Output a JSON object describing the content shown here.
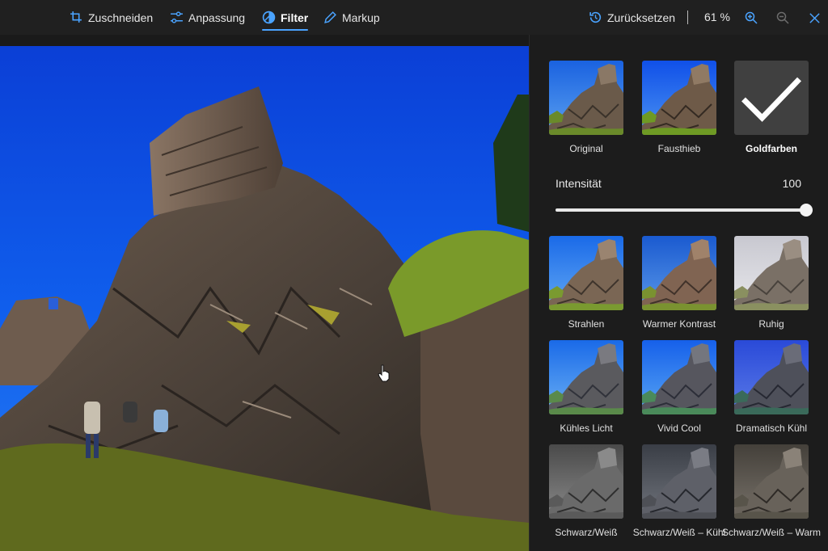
{
  "toolbar": {
    "tools": [
      {
        "label": "Zuschneiden",
        "icon": "crop-icon",
        "active": false
      },
      {
        "label": "Anpassung",
        "icon": "sliders-icon",
        "active": false
      },
      {
        "label": "Filter",
        "icon": "filter-icon",
        "active": true
      },
      {
        "label": "Markup",
        "icon": "pen-icon",
        "active": false
      }
    ],
    "reset_label": "Zurücksetzen",
    "zoom": "61 %",
    "accent_color": "#4aa3ff"
  },
  "panel": {
    "intensity_label": "Intensität",
    "intensity_value": 100,
    "filters": [
      {
        "label": "Original",
        "variant": "original",
        "selected": false
      },
      {
        "label": "Fausthieb",
        "variant": "punch",
        "selected": false
      },
      {
        "label": "Goldfarben",
        "variant": "golden",
        "selected": true
      },
      {
        "label": "Strahlen",
        "variant": "radiate",
        "selected": false
      },
      {
        "label": "Warmer Kontrast",
        "variant": "warm",
        "selected": false
      },
      {
        "label": "Ruhig",
        "variant": "calm",
        "selected": false
      },
      {
        "label": "Kühles Licht",
        "variant": "coollight",
        "selected": false
      },
      {
        "label": "Vivid Cool",
        "variant": "vividcool",
        "selected": false
      },
      {
        "label": "Dramatisch Kühl",
        "variant": "dramaticcool",
        "selected": false
      },
      {
        "label": "Schwarz/Weiß",
        "variant": "bw",
        "selected": false
      },
      {
        "label": "Schwarz/Weiß – Kühl",
        "variant": "bwcool",
        "selected": false
      },
      {
        "label": "Schwarz/Weiß – Warm",
        "variant": "bwwarm",
        "selected": false
      }
    ]
  }
}
